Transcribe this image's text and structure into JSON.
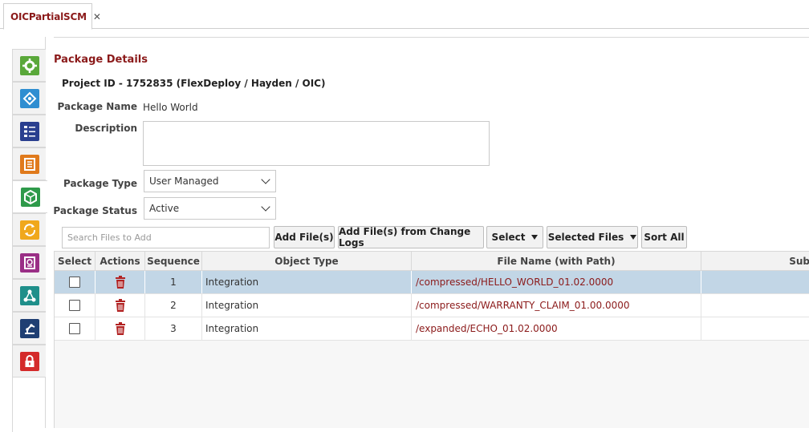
{
  "tab": {
    "label": "OICPartialSCM",
    "close": "✕"
  },
  "rail": {
    "items": [
      {
        "icon": "gear-icon",
        "color": "#5aa83a"
      },
      {
        "icon": "integration-icon",
        "color": "#2f8ed1"
      },
      {
        "icon": "checklist-icon",
        "color": "#2a3f8f"
      },
      {
        "icon": "document-icon",
        "color": "#e07a1c"
      },
      {
        "icon": "package-cube-icon",
        "color": "#2e9a4a"
      },
      {
        "icon": "sync-icon",
        "color": "#f0a81c"
      },
      {
        "icon": "report-icon",
        "color": "#9a2f86"
      },
      {
        "icon": "network-icon",
        "color": "#1f8f8a"
      },
      {
        "icon": "robot-arm-icon",
        "color": "#1f3f73"
      },
      {
        "icon": "lock-icon",
        "color": "#d42a2a"
      }
    ]
  },
  "page": {
    "title": "Package Details",
    "project": "Project ID - 1752835 (FlexDeploy / Hayden / OIC)"
  },
  "form": {
    "package_name_label": "Package Name",
    "package_name_value": "Hello World",
    "description_label": "Description",
    "package_type_label": "Package Type",
    "package_type_value": "User Managed",
    "package_status_label": "Package Status",
    "package_status_value": "Active"
  },
  "toolbar": {
    "search_placeholder": "Search Files to Add",
    "add_files": "Add File(s)",
    "add_from_logs": "Add File(s) from Change Logs",
    "select": "Select",
    "selected_files": "Selected Files",
    "sort_all": "Sort All"
  },
  "table": {
    "headers": [
      "Select",
      "Actions",
      "Sequence",
      "Object Type",
      "File Name (with Path)",
      "Sub"
    ],
    "rows": [
      {
        "sequence": "1",
        "object_type": "Integration",
        "file": "/compressed/HELLO_WORLD_01.02.0000",
        "selected": true
      },
      {
        "sequence": "2",
        "object_type": "Integration",
        "file": "/compressed/WARRANTY_CLAIM_01.00.0000",
        "selected": false
      },
      {
        "sequence": "3",
        "object_type": "Integration",
        "file": "/expanded/ECHO_01.02.0000",
        "selected": false
      }
    ]
  },
  "colors": {
    "accent": "#8b1a1a",
    "row_selected": "#c2d6e6",
    "delete": "#b22222"
  }
}
